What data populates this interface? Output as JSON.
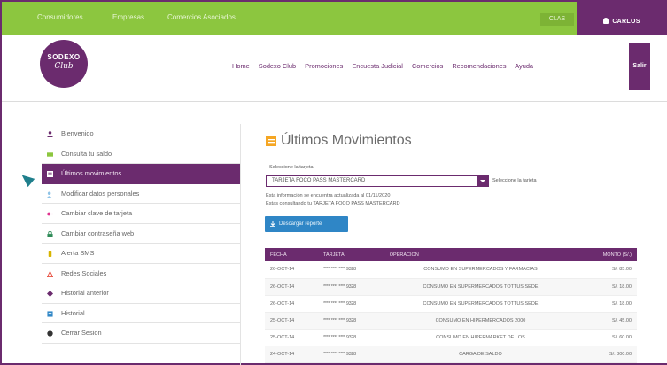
{
  "top_nav": {
    "links": [
      "Consumidores",
      "Empresas",
      "Comercios Asociados"
    ],
    "small_label": "CLAS",
    "user_name": "CARLOS"
  },
  "logo": {
    "brand": "SODEXO",
    "name": "Club"
  },
  "main_nav": {
    "items": [
      "Home",
      "Sodexo Club",
      "Promociones",
      "Encuesta Judicial",
      "Comercios",
      "Recomendaciones",
      "Ayuda"
    ],
    "logout": "Salir"
  },
  "sidebar": {
    "items": [
      {
        "label": "Bienvenido",
        "icon": "user-icon",
        "color": "#6b2b6e"
      },
      {
        "label": "Consulta tu saldo",
        "icon": "wallet-icon",
        "color": "#8cc63f"
      },
      {
        "label": "Últimos movimientos",
        "icon": "list-icon",
        "color": "#f5a623",
        "active": true
      },
      {
        "label": "Modificar datos personales",
        "icon": "person-edit-icon",
        "color": "#2f86c6"
      },
      {
        "label": "Cambiar clave de tarjeta",
        "icon": "key-icon",
        "color": "#e0338f"
      },
      {
        "label": "Cambiar contraseña web",
        "icon": "lock-icon",
        "color": "#2e8b57"
      },
      {
        "label": "Alerta SMS",
        "icon": "phone-icon",
        "color": "#d7b400"
      },
      {
        "label": "Redes Sociales",
        "icon": "share-icon",
        "color": "#e74c3c"
      },
      {
        "label": "Historial anterior",
        "icon": "clock-icon",
        "color": "#6b2b6e"
      },
      {
        "label": "Historial",
        "icon": "document-icon",
        "color": "#2f86c6"
      },
      {
        "label": "Cerrar Sesion",
        "icon": "power-icon",
        "color": "#333333"
      }
    ]
  },
  "content": {
    "title": "Últimos Movimientos",
    "select_label": "Seleccione la tarjeta",
    "select_value": "TARJETA FOCO PASS MASTERCARD",
    "select_side_label": "Seleccione la tarjeta",
    "info_line1": "Esta información se encuentra actualizada al 01/11/2020",
    "info_line2": "Estas consultando tu TARJETA FOCO PASS MASTERCARD",
    "download_label": "Descargar reporte"
  },
  "table": {
    "headers": [
      "FECHA",
      "TARJETA",
      "OPERACIÓN",
      "MONTO (S/.)"
    ],
    "rows": [
      [
        "26-OCT-14",
        "**** **** **** 9328",
        "CONSUMO EN SUPERMERCADOS Y FARMACIAS",
        "S/. 85.00"
      ],
      [
        "26-OCT-14",
        "**** **** **** 9328",
        "CONSUMO EN SUPERMERCADOS TOTTUS SEDE",
        "S/. 18.00"
      ],
      [
        "26-OCT-14",
        "**** **** **** 9328",
        "CONSUMO EN SUPERMERCADOS TOTTUS SEDE",
        "S/. 18.00"
      ],
      [
        "25-OCT-14",
        "**** **** **** 9328",
        "CONSUMO EN HIPERMERCADOS 2000",
        "S/. 45.00"
      ],
      [
        "25-OCT-14",
        "**** **** **** 9328",
        "CONSUMO EN HIPERMARKET DE LOS",
        "S/. 60.00"
      ],
      [
        "24-OCT-14",
        "**** **** **** 9328",
        "CARGA DE SALDO",
        "S/. 300.00"
      ]
    ]
  },
  "colors": {
    "brand_purple": "#6b2b6e",
    "top_green": "#8cc63f",
    "button_blue": "#2f86c6"
  }
}
